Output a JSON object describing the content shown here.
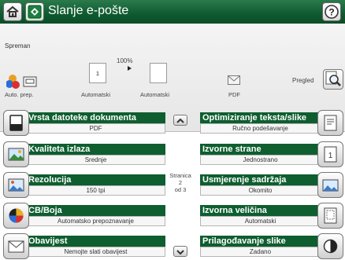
{
  "header": {
    "title": "Slanje e-pošte",
    "colors": {
      "brand_green": "#0e5e2f",
      "header_top": "#2a7a4c"
    }
  },
  "status": {
    "text": "Spreman",
    "zoom": "100%",
    "page_box_value": "1",
    "labels": {
      "preview": "Auto. prep.",
      "auto1": "Automatski",
      "auto2": "Automatski",
      "pdf": "PDF",
      "pregled": "Pregled"
    }
  },
  "tiles": {
    "vrsta_datoteke": {
      "title": "Vrsta datoteke dokumenta",
      "value": "PDF"
    },
    "optimiziranje": {
      "title": "Optimiziranje teksta/slike",
      "value": "Ručno podešavanje"
    },
    "kvaliteta": {
      "title": "Kvaliteta izlaza",
      "value": "Srednje"
    },
    "izvorne_strane": {
      "title": "Izvorne strane",
      "value": "Jednostrano"
    },
    "rezolucija": {
      "title": "Rezolucija",
      "value": "150 tpi"
    },
    "usmjerenje": {
      "title": "Usmjerenje sadržaja",
      "value": "Okomito"
    },
    "cb_boja": {
      "title": "CB/Boja",
      "value": "Automatsko prepoznavanje"
    },
    "izvorna_velicina": {
      "title": "Izvorna veličina",
      "value": "Automatski"
    },
    "obavijest": {
      "title": "Obavijest",
      "value": "Nemojte slati obavijest"
    },
    "prilagodavanje": {
      "title": "Prilagođavanje slike",
      "value": "Zadano"
    }
  },
  "pagination": {
    "line1": "Stranica 2",
    "line2": "od 3"
  },
  "icons": {
    "home": "home-icon",
    "app": "email-app-icon",
    "help": "help-icon",
    "preview": "preview-magnifier-icon",
    "scroll_up": "scroll-up-icon",
    "scroll_down": "scroll-down-icon"
  }
}
